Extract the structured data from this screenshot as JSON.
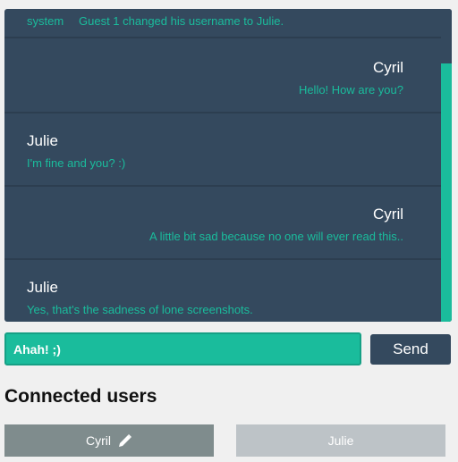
{
  "colors": {
    "panel": "#34495e",
    "accent": "#1abc9c",
    "divider": "#2c3e50",
    "chip_self": "#7f8c8d",
    "chip_other": "#bdc3c7"
  },
  "chat": {
    "system_message": {
      "author": "system",
      "text": "Guest 1 changed his username to Julie."
    },
    "messages": [
      {
        "author": "Cyril",
        "text": "Hello! How are you?",
        "align": "right"
      },
      {
        "author": "Julie",
        "text": "I'm fine and you? :)",
        "align": "left"
      },
      {
        "author": "Cyril",
        "text": "A little bit sad because no one will ever read this..",
        "align": "right"
      },
      {
        "author": "Julie",
        "text": "Yes, that's the sadness of lone screenshots.",
        "align": "left"
      }
    ]
  },
  "composer": {
    "input_value": "Ahah! ;)",
    "send_label": "Send"
  },
  "connected_users": {
    "title": "Connected users",
    "users": [
      {
        "name": "Cyril",
        "icon": "pencil-icon"
      },
      {
        "name": "Julie"
      }
    ]
  }
}
